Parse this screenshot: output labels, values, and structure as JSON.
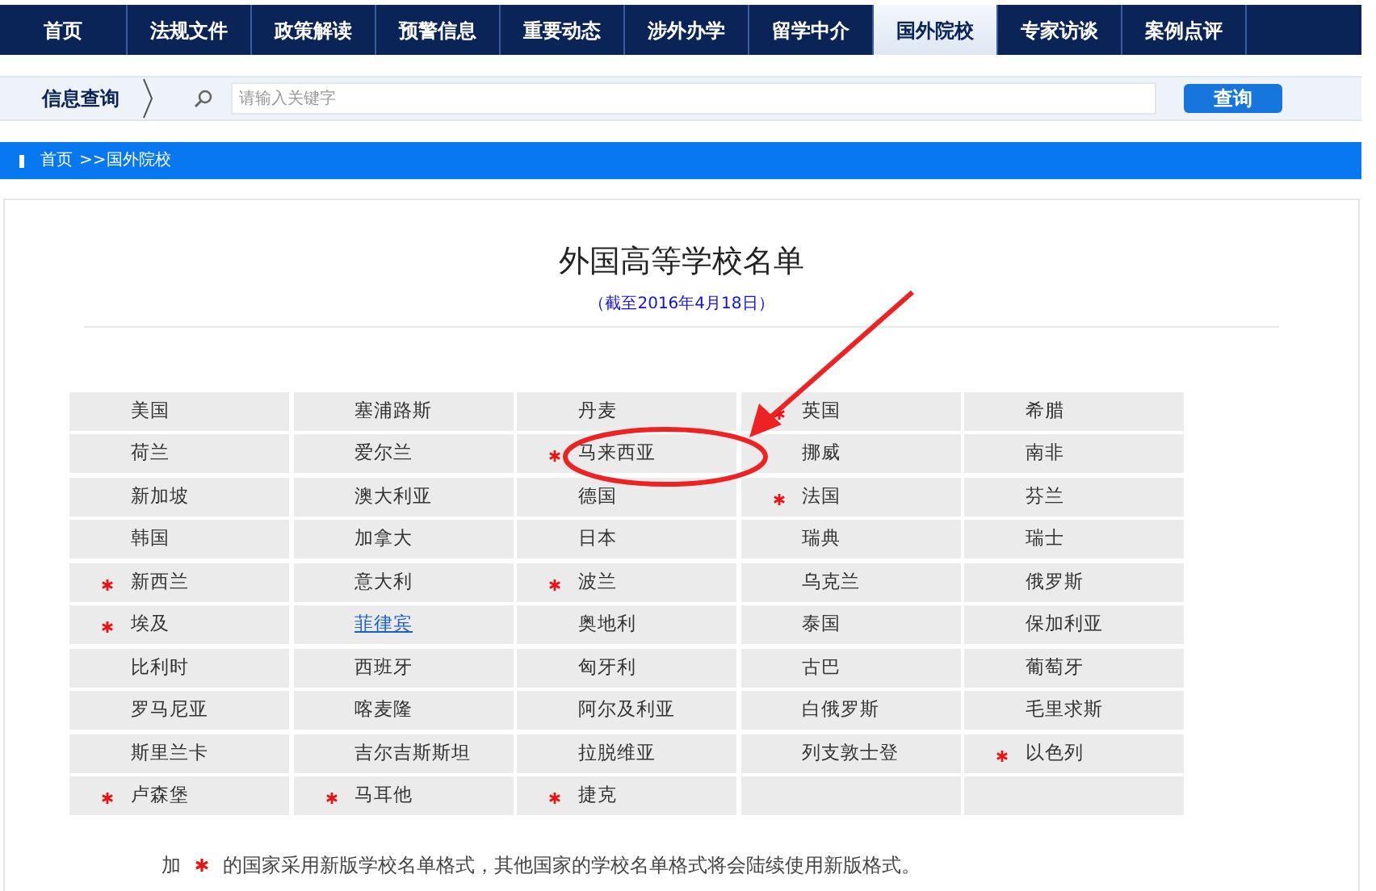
{
  "nav": [
    {
      "label": "首页",
      "selected": false
    },
    {
      "label": "法规文件",
      "selected": false
    },
    {
      "label": "政策解读",
      "selected": false
    },
    {
      "label": "预警信息",
      "selected": false
    },
    {
      "label": "重要动态",
      "selected": false
    },
    {
      "label": "涉外办学",
      "selected": false
    },
    {
      "label": "留学中介",
      "selected": false
    },
    {
      "label": "国外院校",
      "selected": true
    },
    {
      "label": "专家访谈",
      "selected": false
    },
    {
      "label": "案例点评",
      "selected": false
    }
  ],
  "search": {
    "label": "信息查询",
    "placeholder": "请输入关键字",
    "button": "查询"
  },
  "breadcrumb": [
    "首页",
    ">>国外院校"
  ],
  "title": "外国高等学校名单",
  "subtitle": "（截至2016年4月18日）",
  "countries": [
    {
      "name": "美国",
      "marked": false,
      "kind": "text"
    },
    {
      "name": "塞浦路斯",
      "marked": false,
      "kind": "text"
    },
    {
      "name": "丹麦",
      "marked": false,
      "kind": "text"
    },
    {
      "name": "英国",
      "marked": true,
      "kind": "text"
    },
    {
      "name": "希腊",
      "marked": false,
      "kind": "text"
    },
    {
      "name": "荷兰",
      "marked": false,
      "kind": "text"
    },
    {
      "name": "爱尔兰",
      "marked": false,
      "kind": "text"
    },
    {
      "name": "马来西亚",
      "marked": true,
      "kind": "text"
    },
    {
      "name": "挪威",
      "marked": false,
      "kind": "text"
    },
    {
      "name": "南非",
      "marked": false,
      "kind": "text"
    },
    {
      "name": "新加坡",
      "marked": false,
      "kind": "text"
    },
    {
      "name": "澳大利亚",
      "marked": false,
      "kind": "text"
    },
    {
      "name": "德国",
      "marked": false,
      "kind": "text"
    },
    {
      "name": "法国",
      "marked": true,
      "kind": "text"
    },
    {
      "name": "芬兰",
      "marked": false,
      "kind": "text"
    },
    {
      "name": "韩国",
      "marked": false,
      "kind": "text"
    },
    {
      "name": "加拿大",
      "marked": false,
      "kind": "text"
    },
    {
      "name": "日本",
      "marked": false,
      "kind": "text"
    },
    {
      "name": "瑞典",
      "marked": false,
      "kind": "text"
    },
    {
      "name": "瑞士",
      "marked": false,
      "kind": "text"
    },
    {
      "name": "新西兰",
      "marked": true,
      "kind": "text"
    },
    {
      "name": "意大利",
      "marked": false,
      "kind": "text"
    },
    {
      "name": "波兰",
      "marked": true,
      "kind": "text"
    },
    {
      "name": "乌克兰",
      "marked": false,
      "kind": "text"
    },
    {
      "name": "俄罗斯",
      "marked": false,
      "kind": "text"
    },
    {
      "name": "埃及",
      "marked": true,
      "kind": "text"
    },
    {
      "name": "菲律宾",
      "marked": false,
      "kind": "link"
    },
    {
      "name": "奥地利",
      "marked": false,
      "kind": "text"
    },
    {
      "name": "泰国",
      "marked": false,
      "kind": "text"
    },
    {
      "name": "保加利亚",
      "marked": false,
      "kind": "text"
    },
    {
      "name": "比利时",
      "marked": false,
      "kind": "text"
    },
    {
      "name": "西班牙",
      "marked": false,
      "kind": "text"
    },
    {
      "name": "匈牙利",
      "marked": false,
      "kind": "text"
    },
    {
      "name": "古巴",
      "marked": false,
      "kind": "text"
    },
    {
      "name": "葡萄牙",
      "marked": false,
      "kind": "text"
    },
    {
      "name": "罗马尼亚",
      "marked": false,
      "kind": "text"
    },
    {
      "name": "喀麦隆",
      "marked": false,
      "kind": "text"
    },
    {
      "name": "阿尔及利亚",
      "marked": false,
      "kind": "text"
    },
    {
      "name": "白俄罗斯",
      "marked": false,
      "kind": "text"
    },
    {
      "name": "毛里求斯",
      "marked": false,
      "kind": "text"
    },
    {
      "name": "斯里兰卡",
      "marked": false,
      "kind": "text"
    },
    {
      "name": "吉尔吉斯斯坦",
      "marked": false,
      "kind": "text"
    },
    {
      "name": "拉脱维亚",
      "marked": false,
      "kind": "text"
    },
    {
      "name": "列支敦士登",
      "marked": false,
      "kind": "text"
    },
    {
      "name": "以色列",
      "marked": true,
      "kind": "text"
    },
    {
      "name": "卢森堡",
      "marked": true,
      "kind": "text"
    },
    {
      "name": "马耳他",
      "marked": true,
      "kind": "text"
    },
    {
      "name": "捷克",
      "marked": true,
      "kind": "text"
    },
    {
      "kind": "empty"
    },
    {
      "kind": "empty"
    }
  ],
  "note": {
    "prefix": "加",
    "text": "的国家采用新版学校名单格式，其他国家的学校名单格式将会陆续使用新版格式。"
  }
}
